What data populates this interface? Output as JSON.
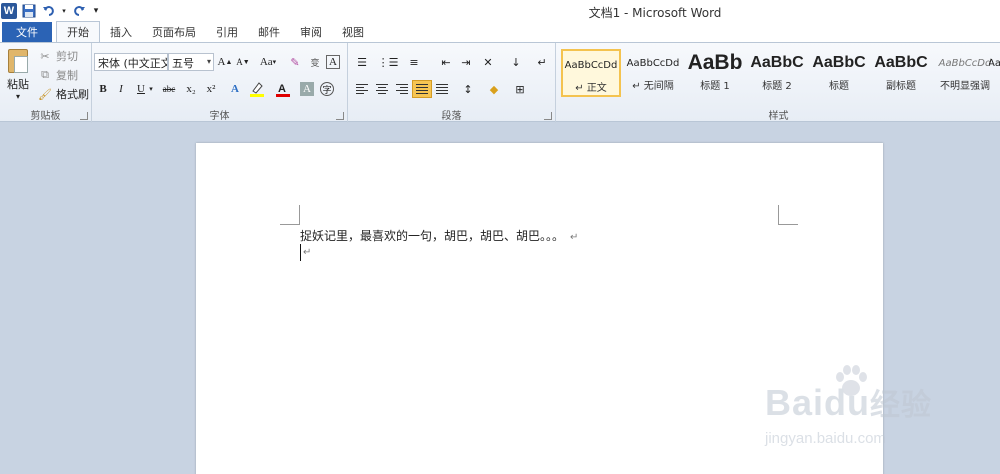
{
  "window": {
    "title": "文档1 - Microsoft Word",
    "qat": [
      "word-logo",
      "save-icon",
      "undo-icon",
      "redo-icon",
      "customize-qat-icon"
    ]
  },
  "tabs": [
    {
      "label": "文件",
      "kind": "file"
    },
    {
      "label": "开始",
      "active": true
    },
    {
      "label": "插入"
    },
    {
      "label": "页面布局"
    },
    {
      "label": "引用"
    },
    {
      "label": "邮件"
    },
    {
      "label": "审阅"
    },
    {
      "label": "视图"
    }
  ],
  "clipboard": {
    "group_label": "剪贴板",
    "paste": "粘贴",
    "cut": "剪切",
    "copy": "复制",
    "format_painter": "格式刷"
  },
  "font": {
    "group_label": "字体",
    "font_name": "宋体 (中文正文",
    "font_size": "五号",
    "grow": "A",
    "shrink": "A",
    "case": "Aa",
    "bold": "B",
    "italic": "I",
    "underline": "U",
    "strike": "abc",
    "subscript": "x₂",
    "superscript": "x²",
    "highlight_color": "#ffff00",
    "font_color": "#e00000"
  },
  "paragraph": {
    "group_label": "段落"
  },
  "styles": {
    "group_label": "样式",
    "items": [
      {
        "sample": "AaBbCcDd",
        "name": "↵ 正文",
        "selected": true
      },
      {
        "sample": "AaBbCcDd",
        "name": "↵ 无间隔"
      },
      {
        "sample": "AaBb",
        "name": "标题 1"
      },
      {
        "sample": "AaBbC",
        "name": "标题 2"
      },
      {
        "sample": "AaBbC",
        "name": "标题"
      },
      {
        "sample": "AaBbC",
        "name": "副标题"
      },
      {
        "sample": "AaBbCcDd",
        "name": "不明显强调"
      },
      {
        "sample": "Aa",
        "name": ""
      }
    ]
  },
  "document": {
    "line1": "捉妖记里，最喜欢的一句，胡巴，胡巴、胡巴。。。",
    "para_mark": "↵"
  },
  "watermark": {
    "logo_left": "Bai",
    "logo_right": "经验",
    "url": "jingyan.baidu.com"
  },
  "colors": {
    "file_tab": "#2b63b5",
    "ribbon_bg": "#e7edf5",
    "workspace": "#c8d3e2"
  }
}
